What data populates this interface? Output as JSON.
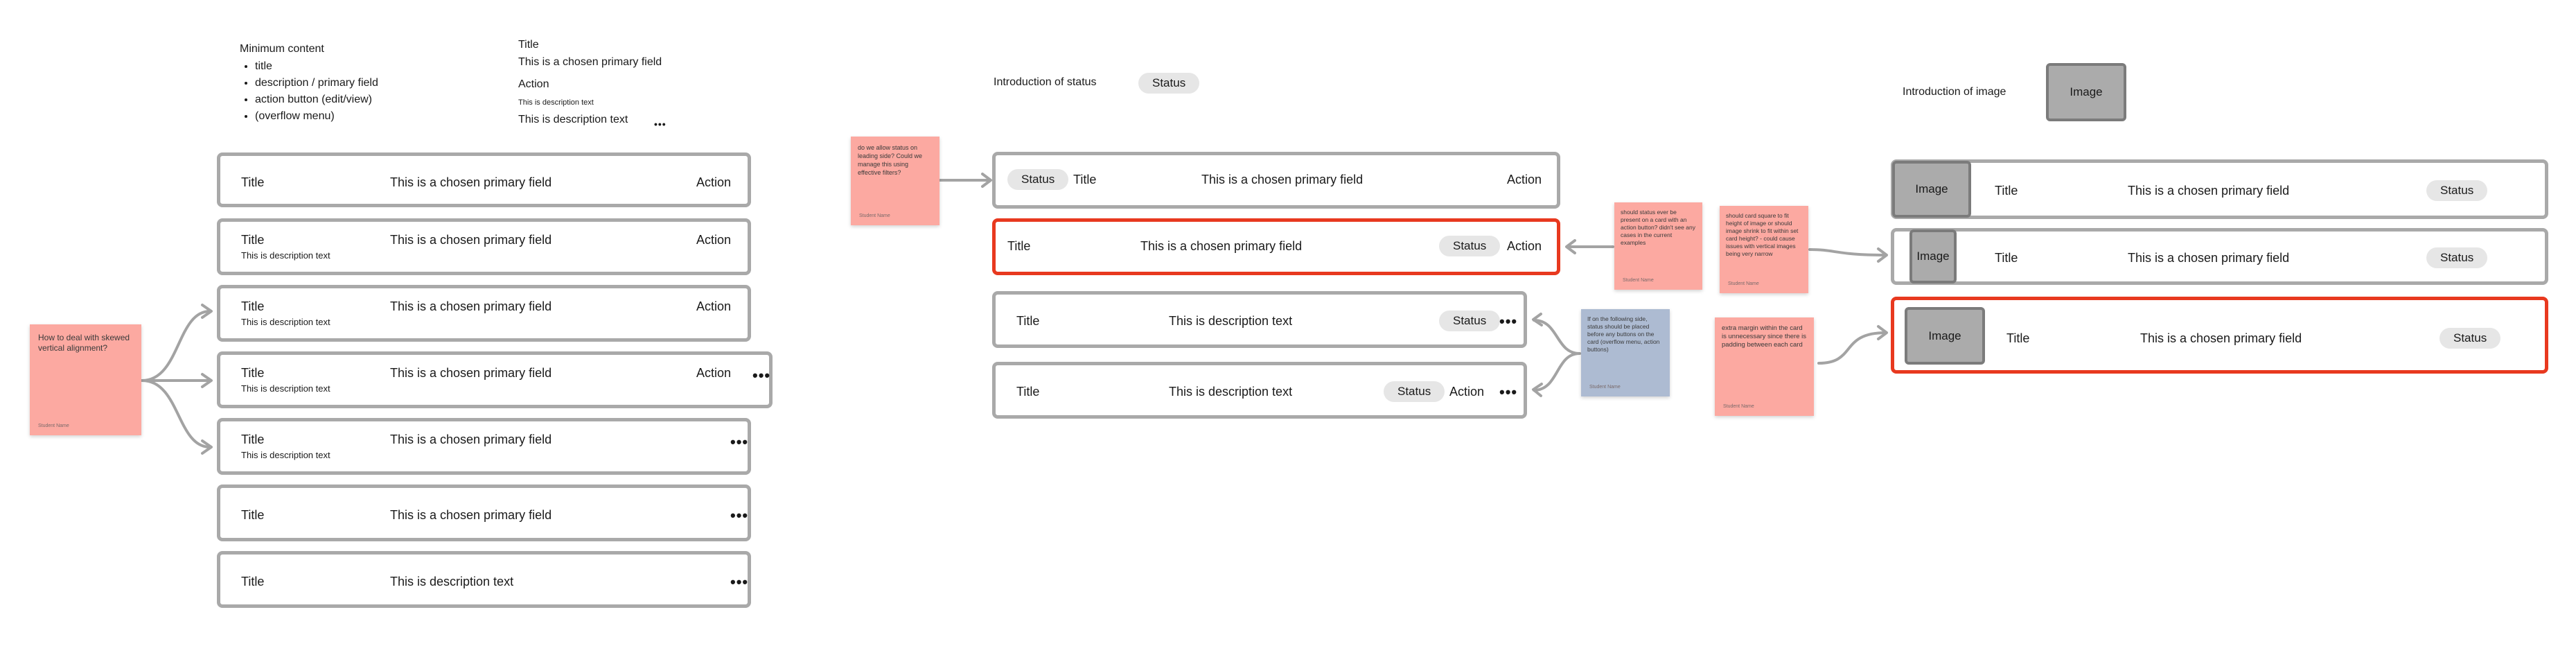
{
  "min_content": {
    "heading": "Minimum content",
    "items": [
      "title",
      "description / primary field",
      "action button (edit/view)",
      "(overflow menu)"
    ]
  },
  "example_card": {
    "title": "Title",
    "primary": "This is a chosen primary field",
    "action": "Action",
    "description": "This is description text",
    "description_large": "This is description text",
    "overflow": "•••"
  },
  "labels": {
    "title": "Title",
    "primary": "This is a chosen primary field",
    "action": "Action",
    "description": "This is description text",
    "status": "Status",
    "image": "Image",
    "overflow": "•••"
  },
  "sections": {
    "status_intro": "Introduction of status",
    "image_intro": "Introduction of image"
  },
  "stickies": {
    "skewed": {
      "text": "How to deal with skewed vertical alignment?",
      "author": "Student Name"
    },
    "status_leading": {
      "text": "do we allow status on leading side? Could we manage this using effective filters?",
      "author": "Student Name"
    },
    "status_action": {
      "text": "should status ever be present on a card with an action button? didn't see any cases in the current examples",
      "author": "Student Name"
    },
    "card_square": {
      "text": "should card square to fit height of image or should image shrink to fit within set card height? - could cause issues with vertical images being very narrow",
      "author": "Student Name"
    },
    "following_side": {
      "text": "If on the following side, status should be placed before any buttons on the card (overflow menu, action buttons)",
      "author": "Student Name"
    },
    "extra_margin": {
      "text": "extra margin within the card is unnecessary since there is padding between each card",
      "author": "Student Name"
    }
  },
  "colors": {
    "card_border": "#a9a9a9",
    "highlight_border": "#e8391f",
    "sticky_pink": "#fca9a1",
    "sticky_blue": "#adbbd2",
    "pill": "#e6e6e6",
    "image_fill": "#ababab"
  }
}
